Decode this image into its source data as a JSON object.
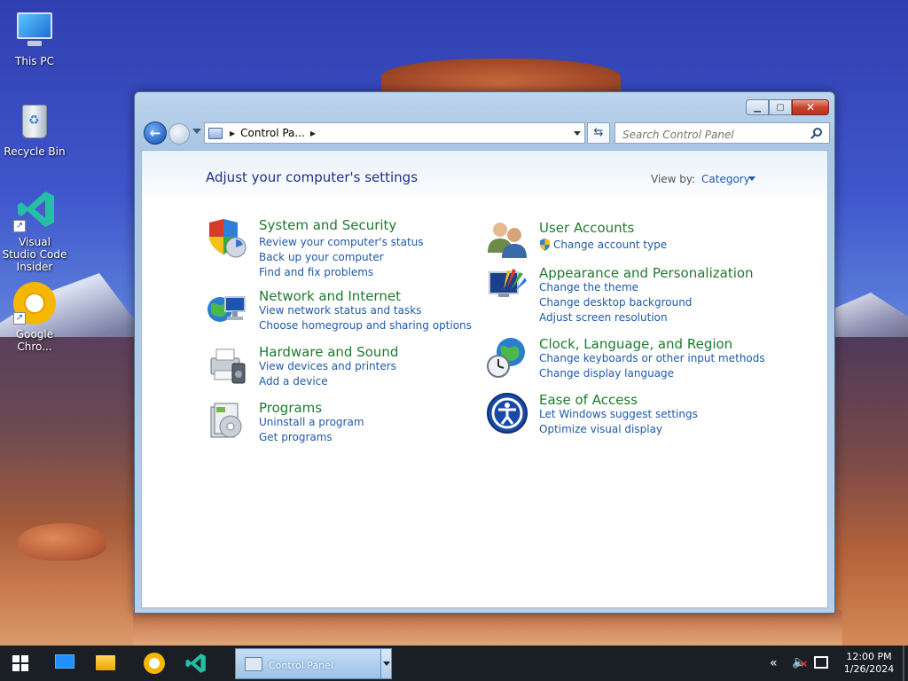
{
  "desktop": {
    "icons": [
      {
        "label": "This PC",
        "icon": "computer-icon"
      },
      {
        "label": "Recycle Bin",
        "icon": "recycle-bin-icon"
      },
      {
        "label": "Visual Studio Code Insider",
        "icon": "vscode-icon"
      },
      {
        "label": "Google Chro...",
        "icon": "chrome-icon"
      }
    ]
  },
  "window": {
    "title_buttons": {
      "minimize": "minimize-icon",
      "maximize": "maximize-icon",
      "close": "close-icon"
    },
    "address": {
      "location": "Control Pa..."
    },
    "search": {
      "placeholder": "Search Control Panel"
    },
    "page_title": "Adjust your computer's settings",
    "view_by": {
      "label": "View by:",
      "value": "Category"
    },
    "categories": [
      {
        "title": "System and Security",
        "icon": "shield-icon",
        "links": [
          "Review your computer's status",
          "Back up your computer",
          "Find and fix problems"
        ]
      },
      {
        "title": "Network and Internet",
        "icon": "network-icon",
        "links": [
          "View network status and tasks",
          "Choose homegroup and sharing options"
        ]
      },
      {
        "title": "Hardware and Sound",
        "icon": "printer-icon",
        "links": [
          "View devices and printers",
          "Add a device"
        ]
      },
      {
        "title": "Programs",
        "icon": "programs-icon",
        "links": [
          "Uninstall a program",
          "Get programs"
        ]
      },
      {
        "title": "User Accounts",
        "icon": "users-icon",
        "links": [
          "Change account type"
        ]
      },
      {
        "title": "Appearance and Personalization",
        "icon": "appearance-icon",
        "links": [
          "Change the theme",
          "Change desktop background",
          "Adjust screen resolution"
        ]
      },
      {
        "title": "Clock, Language, and Region",
        "icon": "clock-globe-icon",
        "links": [
          "Change keyboards or other input methods",
          "Change display language"
        ]
      },
      {
        "title": "Ease of Access",
        "icon": "ease-of-access-icon",
        "links": [
          "Let Windows suggest settings",
          "Optimize visual display"
        ]
      }
    ]
  },
  "taskbar": {
    "active_task": "Control Panel",
    "clock": {
      "time": "12:00 PM",
      "date": "1/26/2024"
    }
  }
}
